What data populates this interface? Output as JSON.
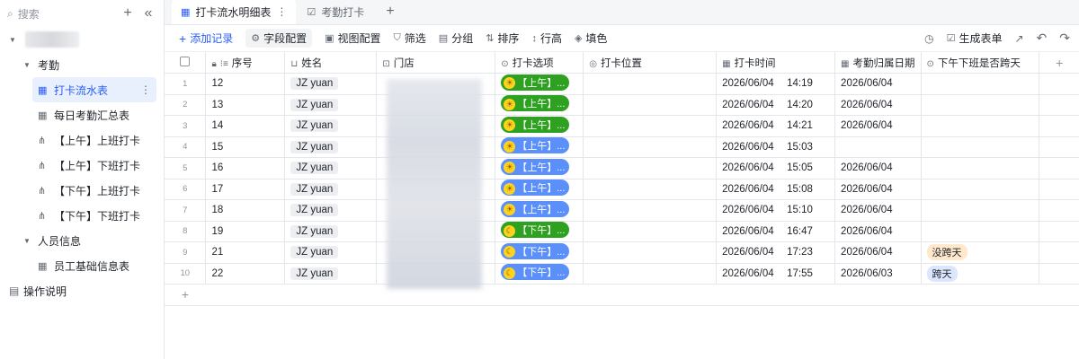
{
  "sidebar": {
    "search": "搜索",
    "groups": [
      {
        "label": "考勤",
        "items": [
          {
            "label": "打卡流水表",
            "icon": "grid-icon",
            "active": true
          },
          {
            "label": "每日考勤汇总表",
            "icon": "grid-icon"
          },
          {
            "label": "【上午】上班打卡",
            "icon": "flow-icon"
          },
          {
            "label": "【上午】下班打卡",
            "icon": "flow-icon"
          },
          {
            "label": "【下午】上班打卡",
            "icon": "flow-icon"
          },
          {
            "label": "【下午】下班打卡",
            "icon": "flow-icon"
          }
        ]
      },
      {
        "label": "人员信息",
        "items": [
          {
            "label": "员工基础信息表",
            "icon": "grid-icon"
          }
        ]
      }
    ],
    "doc": "操作说明"
  },
  "tabs": [
    {
      "label": "打卡流水明细表",
      "active": true
    },
    {
      "label": "考勤打卡"
    }
  ],
  "toolbar": {
    "add": "添加记录",
    "field_cfg": "字段配置",
    "view_cfg": "视图配置",
    "filter": "筛选",
    "group": "分组",
    "sort": "排序",
    "row_height": "行高",
    "fill": "填色",
    "gen_form": "生成表单"
  },
  "columns": [
    "序号",
    "姓名",
    "门店",
    "打卡选项",
    "打卡位置",
    "打卡时间",
    "考勤归属日期",
    "下午下班是否跨天"
  ],
  "rows": [
    {
      "n": "1",
      "seq": "12",
      "name": "JZ yuan",
      "opt": "【上午】...",
      "optc": "green",
      "emo": "☀",
      "date": "2026/06/04",
      "time": "14:19",
      "att": "2026/06/04",
      "cross": ""
    },
    {
      "n": "2",
      "seq": "13",
      "name": "JZ yuan",
      "opt": "【上午】...",
      "optc": "green",
      "emo": "☀",
      "date": "2026/06/04",
      "time": "14:20",
      "att": "2026/06/04",
      "cross": ""
    },
    {
      "n": "3",
      "seq": "14",
      "name": "JZ yuan",
      "opt": "【上午】...",
      "optc": "green",
      "emo": "☀",
      "date": "2026/06/04",
      "time": "14:21",
      "att": "2026/06/04",
      "cross": ""
    },
    {
      "n": "4",
      "seq": "15",
      "name": "JZ yuan",
      "opt": "【上午】...",
      "optc": "blue",
      "emo": "☀",
      "date": "2026/06/04",
      "time": "15:03",
      "att": "",
      "cross": ""
    },
    {
      "n": "5",
      "seq": "16",
      "name": "JZ yuan",
      "opt": "【上午】...",
      "optc": "blue",
      "emo": "☀",
      "date": "2026/06/04",
      "time": "15:05",
      "att": "2026/06/04",
      "cross": ""
    },
    {
      "n": "6",
      "seq": "17",
      "name": "JZ yuan",
      "opt": "【上午】...",
      "optc": "blue",
      "emo": "☀",
      "date": "2026/06/04",
      "time": "15:08",
      "att": "2026/06/04",
      "cross": ""
    },
    {
      "n": "7",
      "seq": "18",
      "name": "JZ yuan",
      "opt": "【上午】...",
      "optc": "blue",
      "emo": "☀",
      "date": "2026/06/04",
      "time": "15:10",
      "att": "2026/06/04",
      "cross": ""
    },
    {
      "n": "8",
      "seq": "19",
      "name": "JZ yuan",
      "opt": "【下午】...",
      "optc": "green",
      "emo": "☾",
      "date": "2026/06/04",
      "time": "16:47",
      "att": "2026/06/04",
      "cross": ""
    },
    {
      "n": "9",
      "seq": "21",
      "name": "JZ yuan",
      "opt": "【下午】...",
      "optc": "blue",
      "emo": "☾",
      "date": "2026/06/04",
      "time": "17:23",
      "att": "2026/06/04",
      "cross": "没跨天",
      "crossc": "orange"
    },
    {
      "n": "10",
      "seq": "22",
      "name": "JZ yuan",
      "opt": "【下午】...",
      "optc": "blue",
      "emo": "☾",
      "date": "2026/06/04",
      "time": "17:55",
      "att": "2026/06/03",
      "cross": "跨天",
      "crossc": "lblue"
    }
  ]
}
